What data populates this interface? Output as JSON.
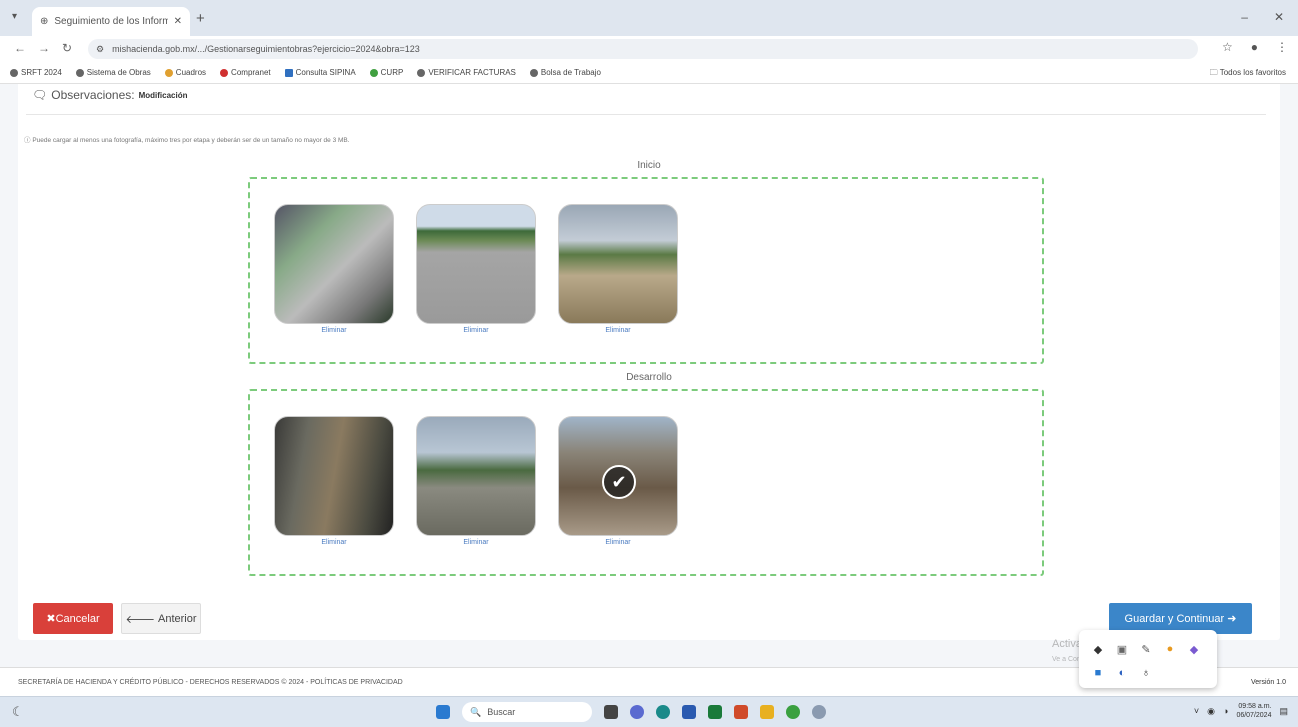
{
  "browser": {
    "tab_title": "Seguimiento de los Informes",
    "url": "mishacienda.gob.mx/.../Gestionarseguimientobras?ejercicio=2024&obra=123",
    "bookmarks": [
      "SRFT 2024",
      "Sistema de Obras",
      "Cuadros",
      "Compranet",
      "Consulta SIPINA",
      "CURP",
      "VERIFICAR FACTURAS",
      "Bolsa de Trabajo"
    ],
    "bookmarks_all": "Todos los favoritos"
  },
  "observaciones": {
    "label": "Observaciones:",
    "value": "Modificación"
  },
  "notice": "Puede cargar al menos una fotografía, máximo tres por etapa y deberán ser de un tamaño no mayor de 3 MB.",
  "groups": [
    {
      "title": "Inicio",
      "captions": [
        "Eliminar",
        "Eliminar",
        "Eliminar"
      ]
    },
    {
      "title": "Desarrollo",
      "captions": [
        "Eliminar",
        "Eliminar",
        "Eliminar"
      ]
    }
  ],
  "buttons": {
    "cancel": "Cancelar",
    "previous": "Anterior",
    "save": "Guardar y Continuar"
  },
  "footer": {
    "text": "SECRETARÍA DE HACIENDA Y CRÉDITO PÚBLICO - DERECHOS RESERVADOS © 2024 - POLÍTICAS DE PRIVACIDAD",
    "version": "Versión 1.0"
  },
  "watermark": {
    "title": "Activar Windows",
    "subtitle": "Ve a Configuración para activar Windows."
  },
  "taskbar": {
    "search_placeholder": "Buscar",
    "time": "09:58 a.m.",
    "date": "06/07/2024"
  }
}
